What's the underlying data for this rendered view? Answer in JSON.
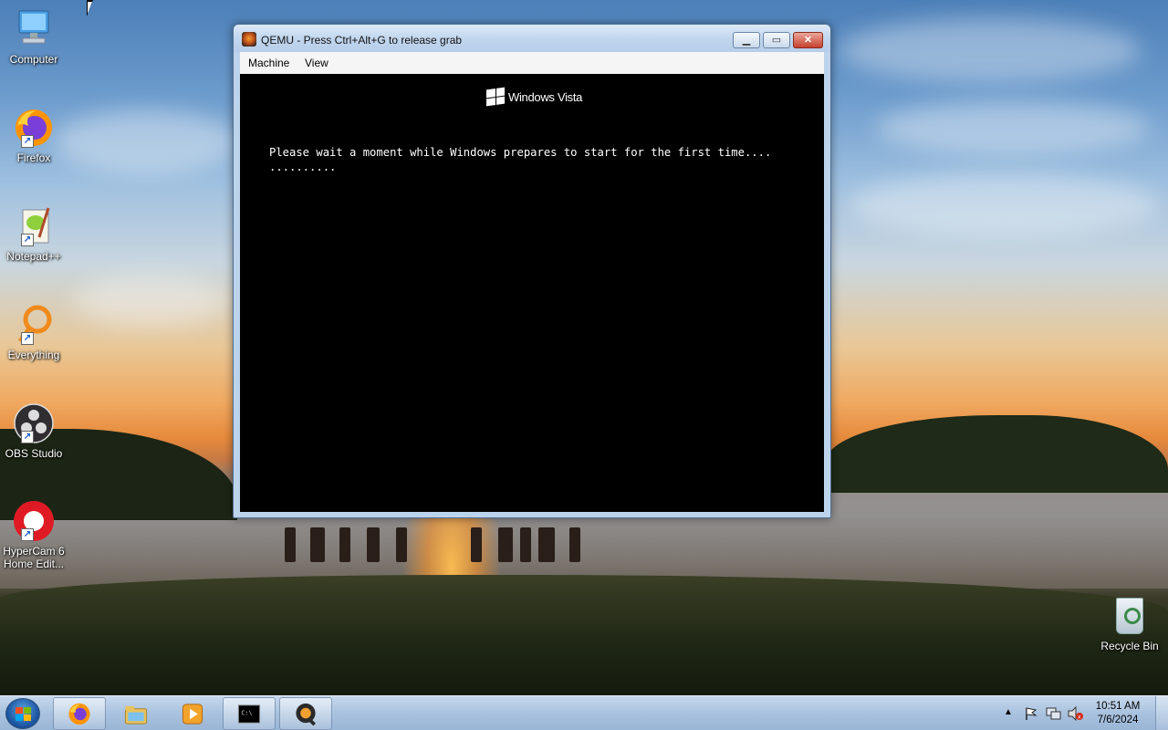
{
  "desktop": {
    "icons": [
      {
        "label": "Computer"
      },
      {
        "label": "Firefox"
      },
      {
        "label": "Notepad++"
      },
      {
        "label": "Everything"
      },
      {
        "label": "OBS Studio"
      },
      {
        "label": "HyperCam 6 Home Edit..."
      }
    ],
    "recycle_bin": {
      "label": "Recycle Bin"
    }
  },
  "window": {
    "title": "QEMU - Press Ctrl+Alt+G to release grab",
    "menu": {
      "machine": "Machine",
      "view": "View"
    },
    "screen": {
      "logo_text": "Windows Vista",
      "line1": "Please wait a moment while Windows prepares to start for the first time....",
      "line2": ".........."
    }
  },
  "taskbar": {
    "buttons": [
      {
        "icon": "firefox-icon"
      },
      {
        "icon": "file-explorer-icon"
      },
      {
        "icon": "media-player-icon"
      },
      {
        "icon": "command-prompt-icon"
      },
      {
        "icon": "qemu-icon"
      }
    ],
    "clock": {
      "time": "10:51 AM",
      "date": "7/6/2024"
    }
  }
}
